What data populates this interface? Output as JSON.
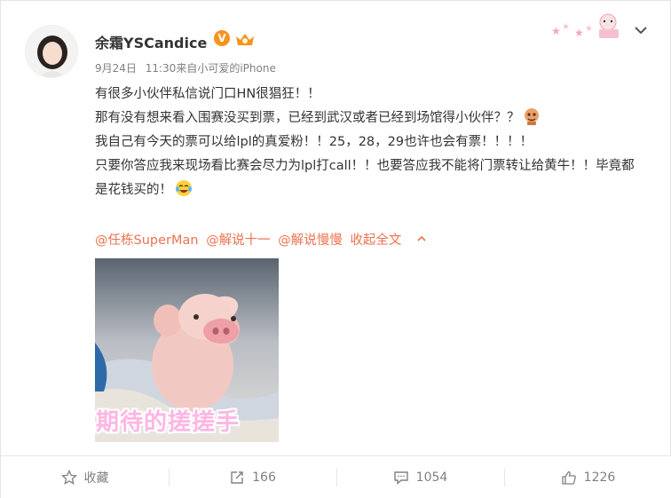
{
  "post": {
    "user": {
      "name": "余霜YSCandice",
      "verified_mark": "V"
    },
    "meta": {
      "date": "9月24日",
      "time": "11:30",
      "source": "来自小可爱的iPhone"
    },
    "text_lines": [
      "有很多小伙伴私信说门口HN很猖狂！！",
      "那有没有想来看入围赛没买到票，已经到武汉或者已经到场馆得小伙伴？？",
      "我自己有今天的票可以给lpl的真爱粉！！25，28，29也许也会有票！！！！",
      "只要你答应我来现场看比赛会尽力为lpl打call！！也要答应我不能将门票转让给黄牛！！毕竟都是花钱买的！"
    ],
    "mentions": [
      "@任栋SuperMan",
      "@解说十一",
      "@解说慢慢"
    ],
    "collapse_label": "收起全文",
    "image_caption": "期待的搓搓手"
  },
  "actions": {
    "favorite_label": "收藏",
    "repost_count": "166",
    "comment_count": "1054",
    "like_count": "1226"
  },
  "colors": {
    "link": "#eb7350",
    "text": "#333333",
    "meta": "#808080",
    "badge": "#f7931e"
  },
  "icons": [
    "avatar",
    "verified-badge",
    "member-crown-icon",
    "decor-sticker",
    "chevron-down-icon",
    "puppet-emoji-icon",
    "laugh-cry-emoji-icon",
    "chevron-up-icon",
    "star-icon",
    "repost-icon",
    "comment-icon",
    "thumbs-up-icon"
  ]
}
